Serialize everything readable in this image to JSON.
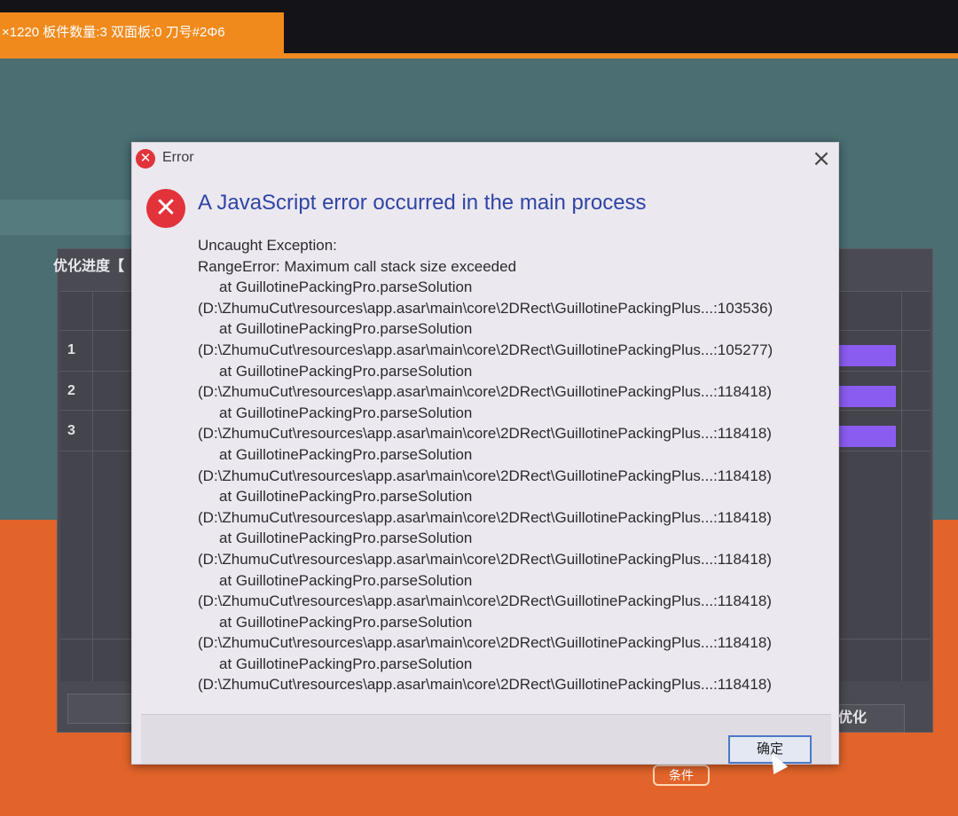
{
  "app": {
    "info_bar": "×1220 板件数量:3 双面板:0 刀号#2Φ6",
    "progress_title": "优化进度【",
    "rows": [
      "1",
      "2",
      "3"
    ],
    "stop_button": "止优化",
    "bottom_button": "条件"
  },
  "dialog": {
    "title": "Error",
    "close": "×",
    "headline": "A JavaScript error occurred in the main process",
    "lines": [
      "Uncaught Exception:",
      "RangeError: Maximum call stack size exceeded",
      "at GuillotinePackingPro.parseSolution",
      "(D:\\ZhumuCut\\resources\\app.asar\\main\\core\\2DRect\\GuillotinePackingPlus...:103536)",
      "at GuillotinePackingPro.parseSolution",
      "(D:\\ZhumuCut\\resources\\app.asar\\main\\core\\2DRect\\GuillotinePackingPlus...:105277)",
      "at GuillotinePackingPro.parseSolution",
      "(D:\\ZhumuCut\\resources\\app.asar\\main\\core\\2DRect\\GuillotinePackingPlus...:118418)",
      "at GuillotinePackingPro.parseSolution",
      "(D:\\ZhumuCut\\resources\\app.asar\\main\\core\\2DRect\\GuillotinePackingPlus...:118418)",
      "at GuillotinePackingPro.parseSolution",
      "(D:\\ZhumuCut\\resources\\app.asar\\main\\core\\2DRect\\GuillotinePackingPlus...:118418)",
      "at GuillotinePackingPro.parseSolution",
      "(D:\\ZhumuCut\\resources\\app.asar\\main\\core\\2DRect\\GuillotinePackingPlus...:118418)",
      "at GuillotinePackingPro.parseSolution",
      "(D:\\ZhumuCut\\resources\\app.asar\\main\\core\\2DRect\\GuillotinePackingPlus...:118418)",
      "at GuillotinePackingPro.parseSolution",
      "(D:\\ZhumuCut\\resources\\app.asar\\main\\core\\2DRect\\GuillotinePackingPlus...:118418)",
      "at GuillotinePackingPro.parseSolution",
      "(D:\\ZhumuCut\\resources\\app.asar\\main\\core\\2DRect\\GuillotinePackingPlus...:118418)",
      "at GuillotinePackingPro.parseSolution",
      "(D:\\ZhumuCut\\resources\\app.asar\\main\\core\\2DRect\\GuillotinePackingPlus...:118418)"
    ],
    "ok_button": "确定"
  },
  "colors": {
    "accent_orange": "#f08a1c",
    "error_red": "#e2323a",
    "headline_blue": "#2f45a6",
    "progress_purple": "#8b5cf0"
  },
  "icons": {
    "title": "error-icon",
    "main": "error-icon",
    "close": "close-icon"
  }
}
